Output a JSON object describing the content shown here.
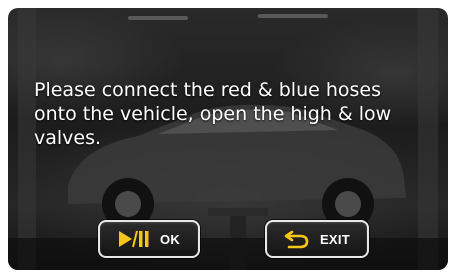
{
  "message": {
    "line1": "Please connect the red & blue hoses",
    "line2": "onto the vehicle, open the high & low",
    "line3": "valves."
  },
  "buttons": {
    "ok": {
      "label": "OK",
      "icon": "play-pause-icon"
    },
    "exit": {
      "label": "EXIT",
      "icon": "return-arrow-icon"
    }
  },
  "colors": {
    "icon_accent": "#f5c518",
    "button_border": "#e8e8e8",
    "text": "#ffffff"
  }
}
